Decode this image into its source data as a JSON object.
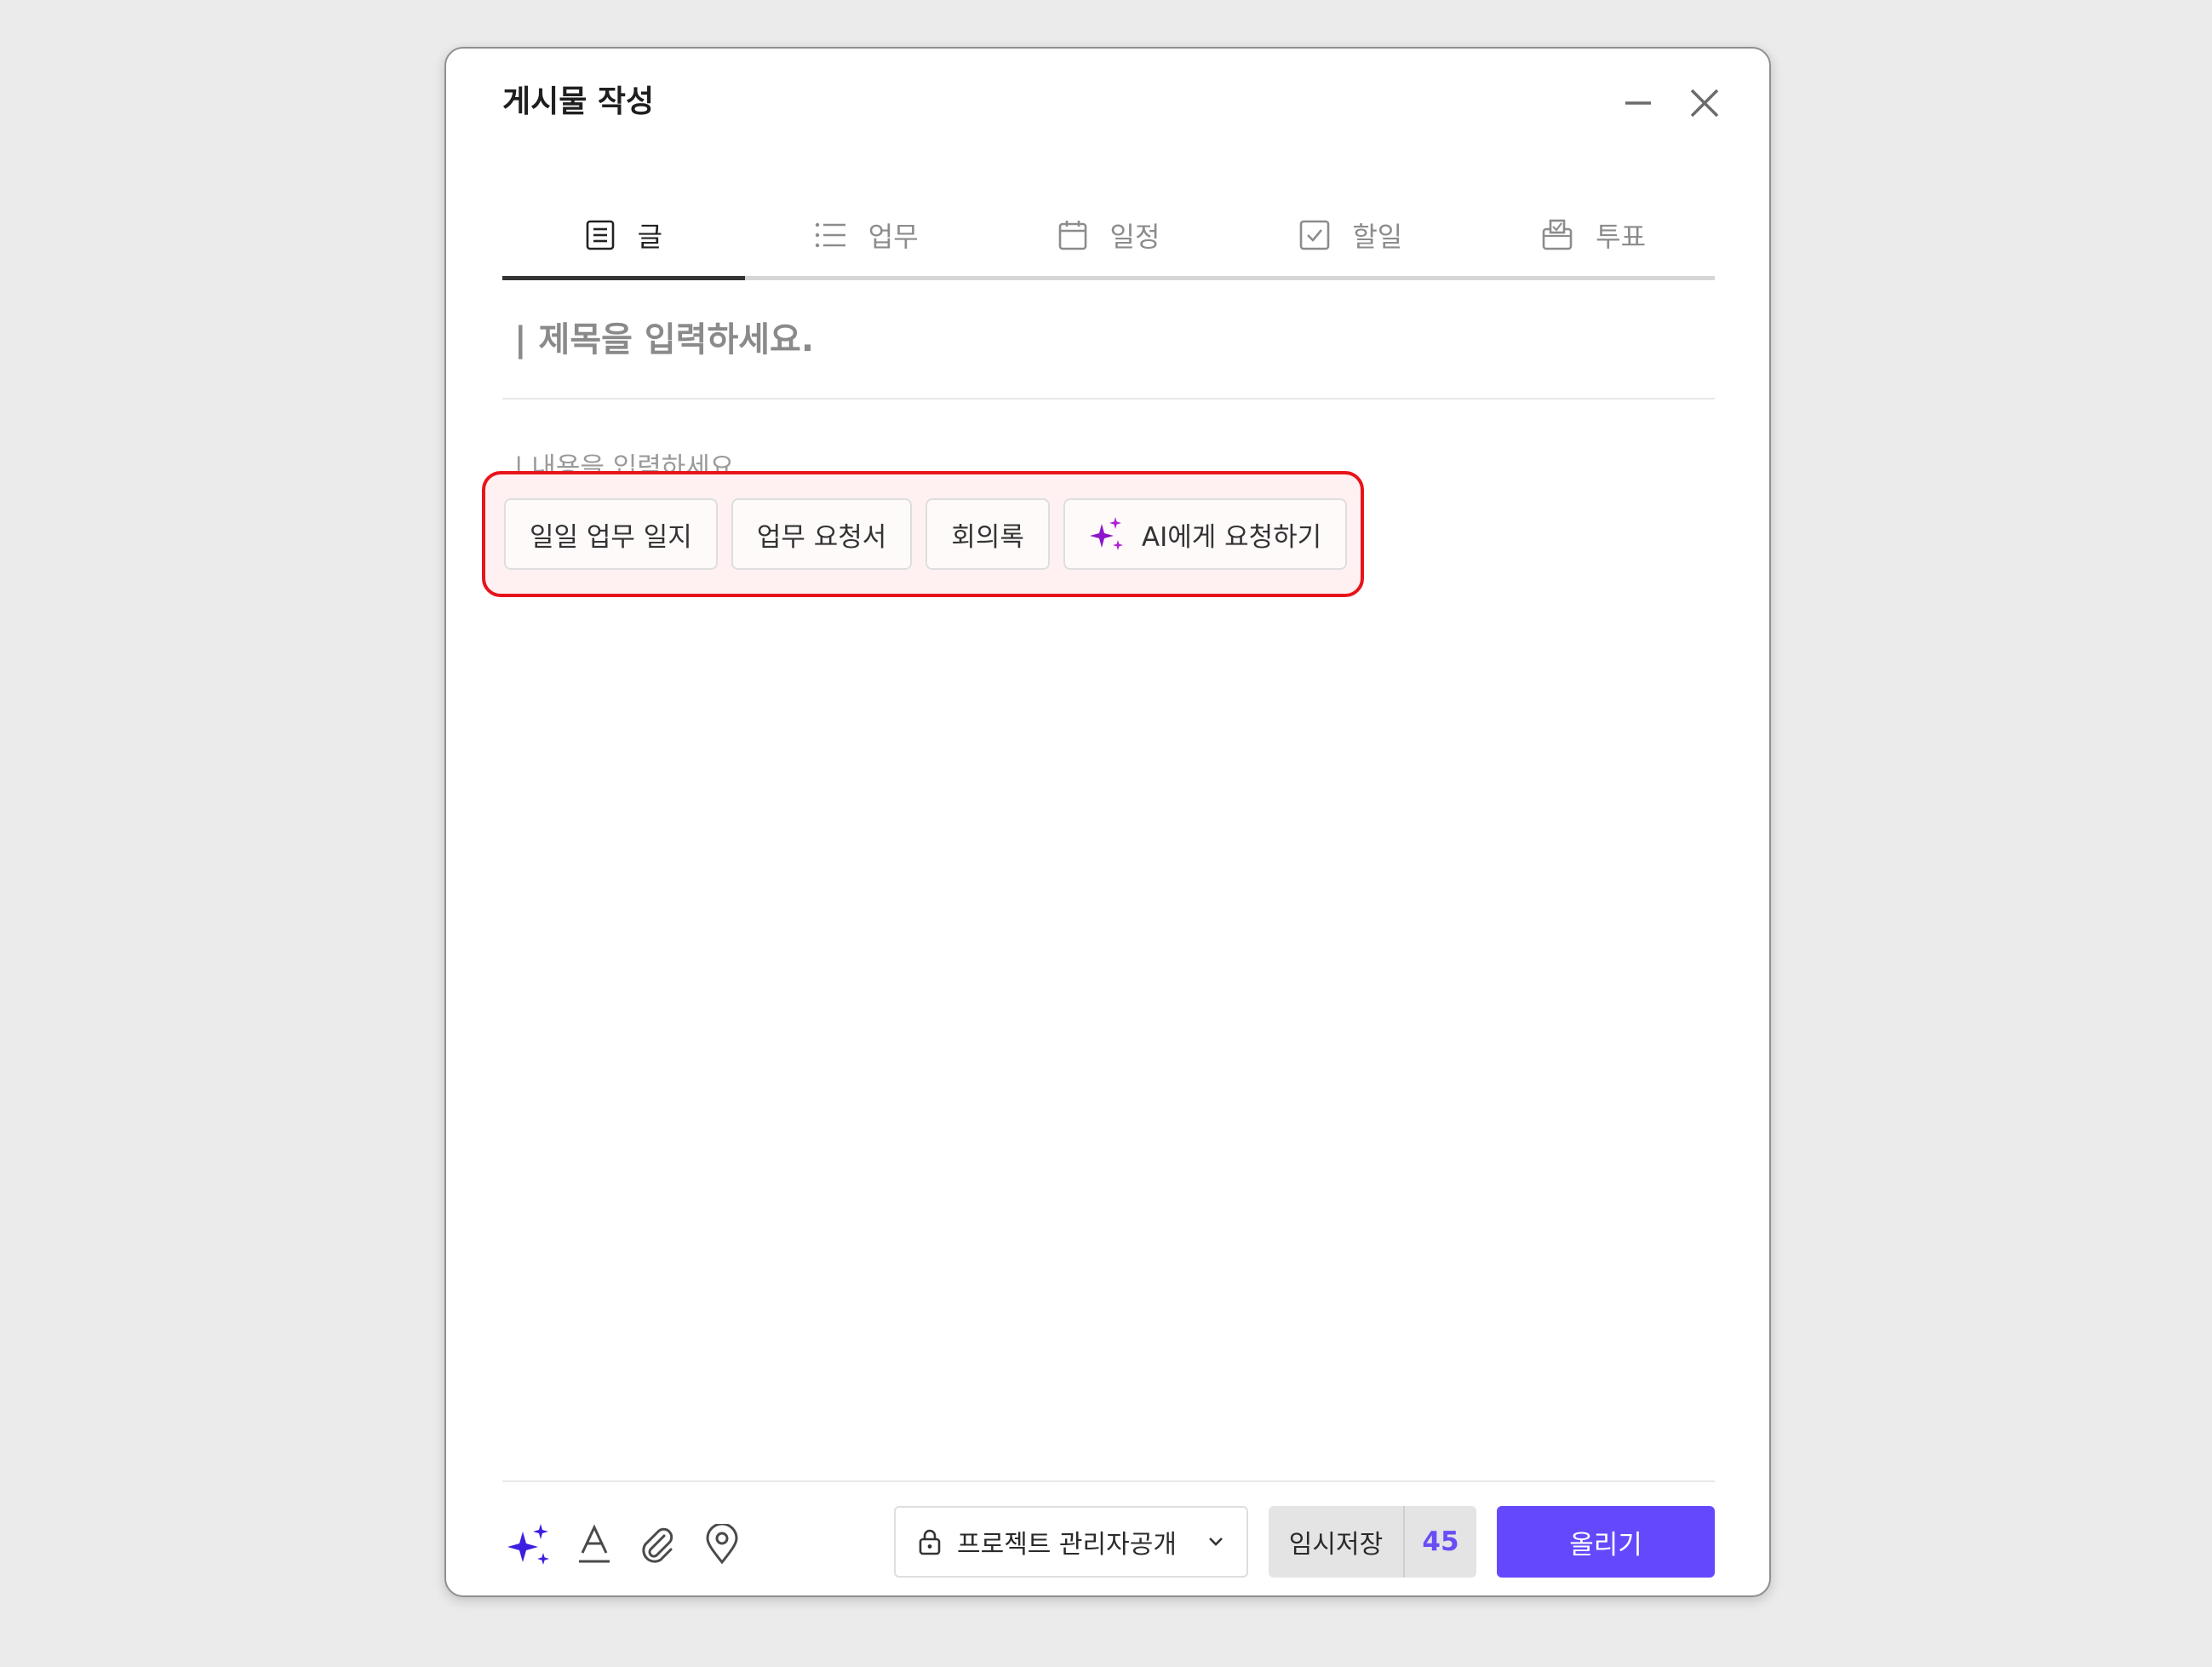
{
  "header": {
    "title": "게시물 작성",
    "minimize_icon": "minimize-icon",
    "close_icon": "close-icon"
  },
  "tabs": [
    {
      "label": "글",
      "icon": "document-icon",
      "active": true
    },
    {
      "label": "업무",
      "icon": "list-icon",
      "active": false
    },
    {
      "label": "일정",
      "icon": "calendar-icon",
      "active": false
    },
    {
      "label": "할일",
      "icon": "checkbox-icon",
      "active": false
    },
    {
      "label": "투표",
      "icon": "vote-box-icon",
      "active": false
    }
  ],
  "editor": {
    "title_placeholder": "| 제목을 입력하세요.",
    "body_placeholder": "| 내용을 입력하세요."
  },
  "templates": {
    "items": [
      "일일 업무 일지",
      "업무 요청서",
      "회의록"
    ],
    "ai_label": "AI에게 요청하기",
    "highlight_color": "#e8141b"
  },
  "footer": {
    "tools": [
      "sparkle-ai-icon",
      "font-icon",
      "attach-icon",
      "location-icon"
    ],
    "privacy_label": "프로젝트 관리자공개",
    "draft_label": "임시저장",
    "draft_count": "45",
    "submit_label": "올리기",
    "accent_color": "#6449fc"
  }
}
